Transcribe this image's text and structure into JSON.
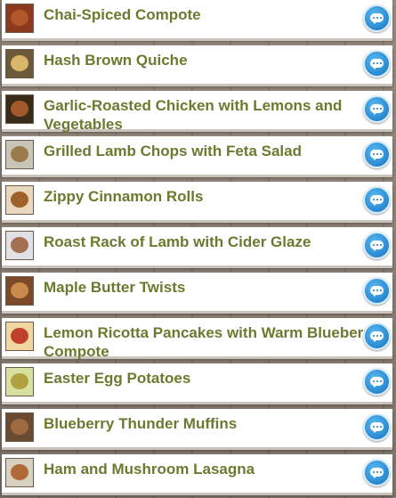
{
  "recipes": [
    {
      "title": "Chai-Spiced Compote",
      "thumb_color": "#8b3a1f",
      "plate_color": "#b4552a"
    },
    {
      "title": "Hash Brown Quiche",
      "thumb_color": "#6a5a3a",
      "plate_color": "#d9b66a"
    },
    {
      "title": "Garlic-Roasted Chicken with Lemons and Vegetables",
      "thumb_color": "#3a2a1a",
      "plate_color": "#a35a2a"
    },
    {
      "title": "Grilled Lamb Chops with Feta Salad",
      "thumb_color": "#c9c4b8",
      "plate_color": "#9a7b4a"
    },
    {
      "title": "Zippy Cinnamon Rolls",
      "thumb_color": "#e8d8c0",
      "plate_color": "#a0602a"
    },
    {
      "title": "Roast Rack of Lamb with Cider Glaze",
      "thumb_color": "#e0e0e6",
      "plate_color": "#a47050"
    },
    {
      "title": "Maple Butter Twists",
      "thumb_color": "#7a4a2a",
      "plate_color": "#c98a4a"
    },
    {
      "title": "Lemon Ricotta Pancakes with Warm Blueberry Compote",
      "thumb_color": "#f0d6a0",
      "plate_color": "#c0402a"
    },
    {
      "title": "Easter Egg Potatoes",
      "thumb_color": "#d8e0a0",
      "plate_color": "#b0a040"
    },
    {
      "title": "Blueberry Thunder Muffins",
      "thumb_color": "#6a4a30",
      "plate_color": "#a06a40"
    },
    {
      "title": "Ham and Mushroom Lasagna",
      "thumb_color": "#d8d0c0",
      "plate_color": "#b06a3a"
    }
  ],
  "action_icon": "chat-bubble-icon",
  "accent_color": "#2e8fd6",
  "title_color": "#6b7a2f"
}
